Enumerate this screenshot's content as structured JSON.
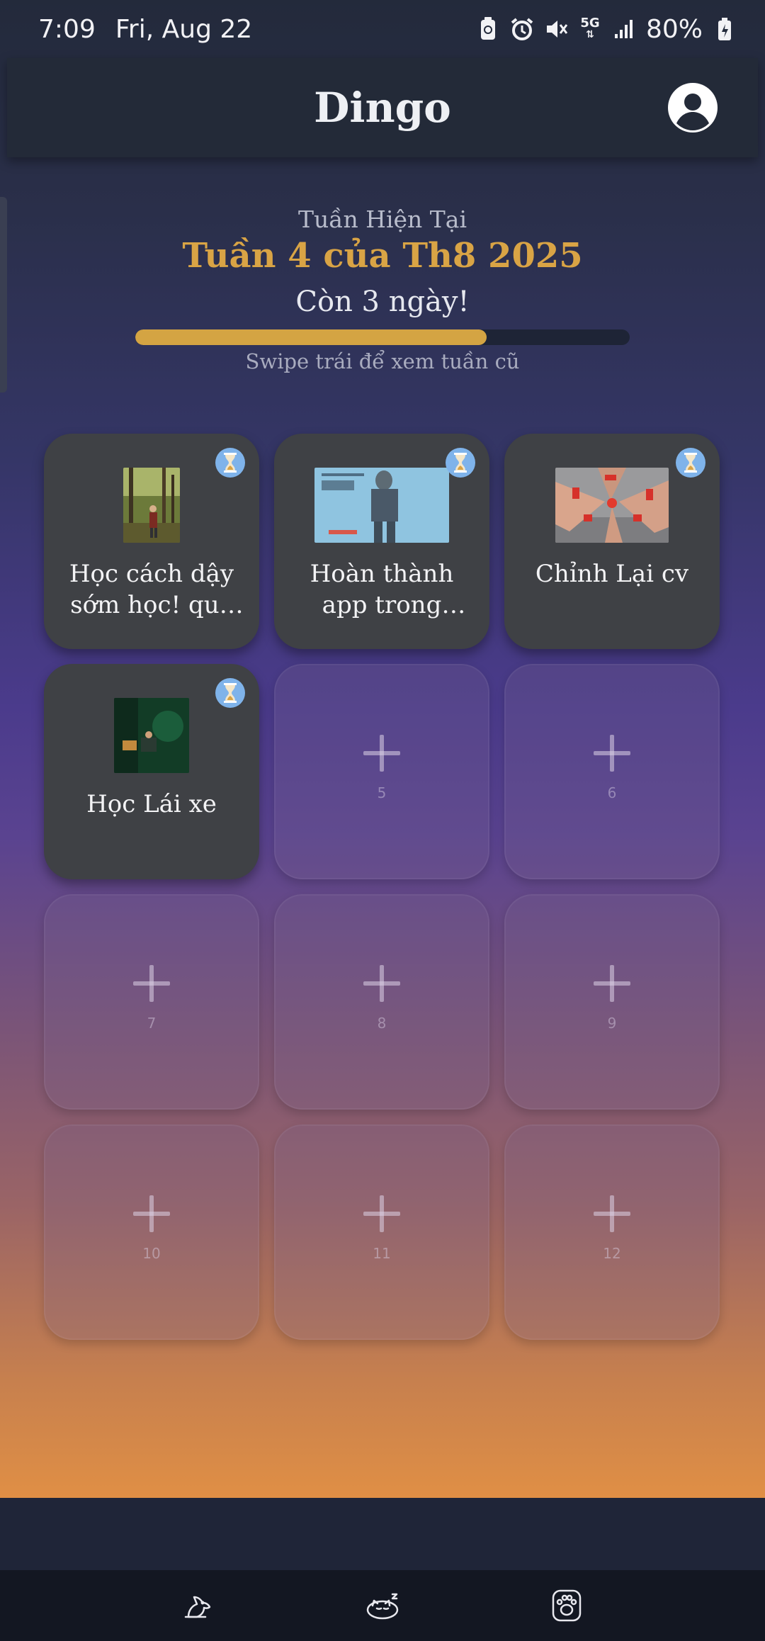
{
  "status_bar": {
    "time": "7:09",
    "date": "Fri, Aug 22",
    "battery": "80%",
    "network": "5G",
    "icons": [
      "battery-saver-icon",
      "alarm-icon",
      "mute-icon",
      "5g-icon",
      "signal-icon",
      "battery-icon"
    ]
  },
  "header": {
    "title": "Dingo",
    "profile_icon": "account-circle-icon"
  },
  "week": {
    "label": "Tuần Hiện Tại",
    "title": "Tuần 4 của Th8 2025",
    "days_left": "Còn 3 ngày!",
    "progress": 0.71,
    "swipe_hint": "Swipe trái để xem tuần cũ"
  },
  "goals": [
    {
      "title": "Học cách dậy sớm học! quý …",
      "status_icon": "hourglass-icon"
    },
    {
      "title": "Hoàn thành app trong tuầ…",
      "status_icon": "hourglass-icon"
    },
    {
      "title": "Chỉnh Lại cv",
      "status_icon": "hourglass-icon"
    },
    {
      "title": "Học Lái xe",
      "status_icon": "hourglass-icon"
    }
  ],
  "empty_slots": [
    "5",
    "6",
    "7",
    "8",
    "9",
    "10",
    "11",
    "12"
  ],
  "nav": {
    "items": [
      "dog-icon",
      "sleeping-cat-icon",
      "paw-icon"
    ]
  },
  "colors": {
    "accent": "#d9a445",
    "timer": "#7fb3ea",
    "card": "#3f4145"
  }
}
